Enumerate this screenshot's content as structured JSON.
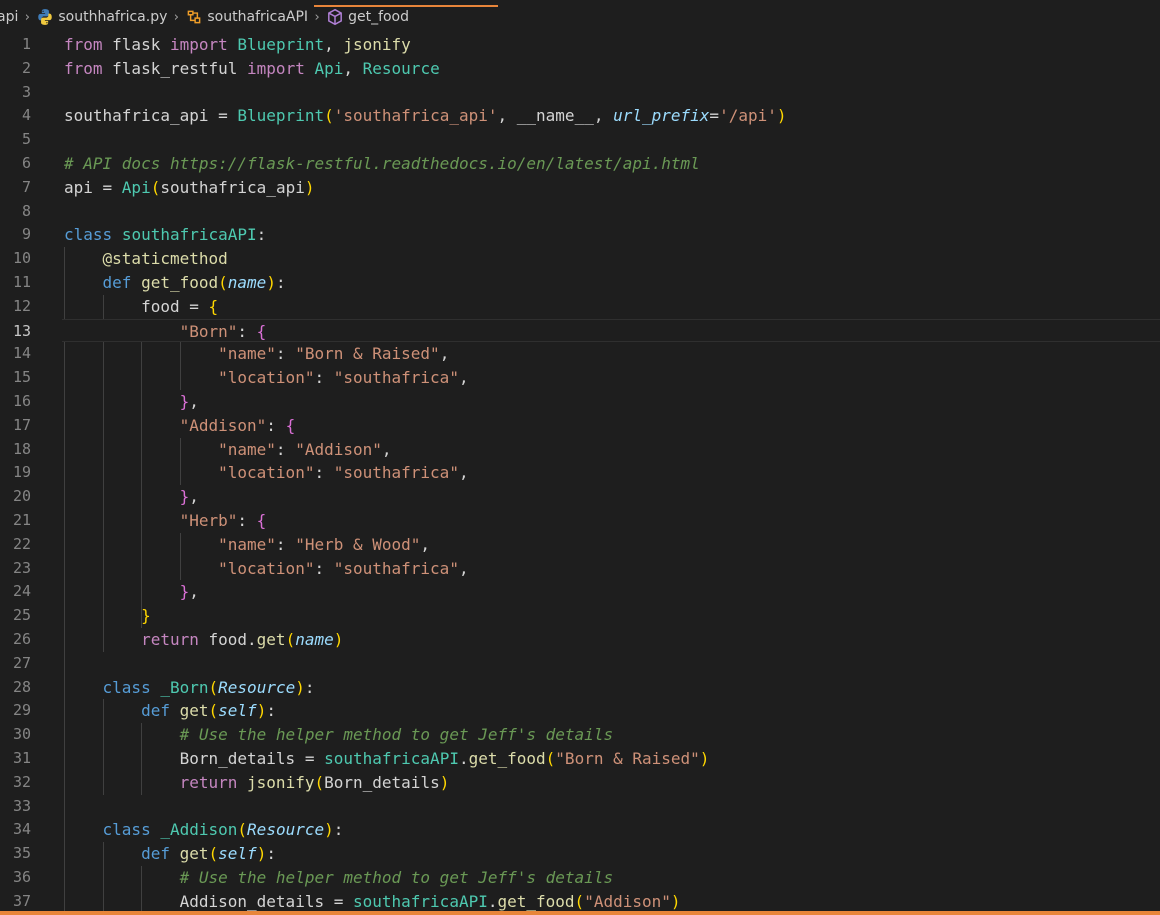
{
  "breadcrumb": {
    "root": "api",
    "file": "southhafrica.py",
    "class": "southafricaAPI",
    "method": "get_food"
  },
  "editor": {
    "active_line": 13,
    "lines": [
      {
        "n": "1",
        "segs": [
          [
            "kw",
            "from"
          ],
          [
            "punc",
            " flask "
          ],
          [
            "kw",
            "import"
          ],
          [
            "punc",
            " "
          ],
          [
            "cls",
            "Blueprint"
          ],
          [
            "punc",
            ", "
          ],
          [
            "func",
            "jsonify"
          ]
        ]
      },
      {
        "n": "2",
        "segs": [
          [
            "kw",
            "from"
          ],
          [
            "punc",
            " flask_restful "
          ],
          [
            "kw",
            "import"
          ],
          [
            "punc",
            " "
          ],
          [
            "cls",
            "Api"
          ],
          [
            "punc",
            ", "
          ],
          [
            "cls",
            "Resource"
          ]
        ]
      },
      {
        "n": "3",
        "segs": []
      },
      {
        "n": "4",
        "segs": [
          [
            "punc",
            "southafrica_api = "
          ],
          [
            "cls",
            "Blueprint"
          ],
          [
            "br1",
            "("
          ],
          [
            "str",
            "'southafrica_api'"
          ],
          [
            "punc",
            ", __name__, "
          ],
          [
            "param",
            "url_prefix"
          ],
          [
            "punc",
            "="
          ],
          [
            "str",
            "'/api'"
          ],
          [
            "br1",
            ")"
          ]
        ]
      },
      {
        "n": "5",
        "segs": []
      },
      {
        "n": "6",
        "segs": [
          [
            "cmt",
            "# API docs https://flask-restful.readthedocs.io/en/latest/api.html"
          ]
        ]
      },
      {
        "n": "7",
        "segs": [
          [
            "punc",
            "api = "
          ],
          [
            "cls",
            "Api"
          ],
          [
            "br1",
            "("
          ],
          [
            "punc",
            "southafrica_api"
          ],
          [
            "br1",
            ")"
          ]
        ]
      },
      {
        "n": "8",
        "segs": []
      },
      {
        "n": "9",
        "segs": [
          [
            "kwb",
            "class"
          ],
          [
            "punc",
            " "
          ],
          [
            "cls",
            "southafricaAPI"
          ],
          [
            "punc",
            ":"
          ]
        ]
      },
      {
        "n": "10",
        "segs": [
          [
            "punc",
            "    "
          ],
          [
            "dec",
            "@staticmethod"
          ]
        ]
      },
      {
        "n": "11",
        "segs": [
          [
            "punc",
            "    "
          ],
          [
            "kwb",
            "def"
          ],
          [
            "punc",
            " "
          ],
          [
            "func",
            "get_food"
          ],
          [
            "br1",
            "("
          ],
          [
            "param",
            "name"
          ],
          [
            "br1",
            ")"
          ],
          [
            "punc",
            ":"
          ]
        ]
      },
      {
        "n": "12",
        "segs": [
          [
            "punc",
            "        food = "
          ],
          [
            "br1",
            "{"
          ]
        ]
      },
      {
        "n": "13",
        "segs": [
          [
            "punc",
            "            "
          ],
          [
            "str",
            "\"Born\""
          ],
          [
            "punc",
            ": "
          ],
          [
            "br2",
            "{"
          ]
        ]
      },
      {
        "n": "14",
        "segs": [
          [
            "punc",
            "                "
          ],
          [
            "str",
            "\"name\""
          ],
          [
            "punc",
            ": "
          ],
          [
            "str",
            "\"Born & Raised\""
          ],
          [
            "punc",
            ","
          ]
        ]
      },
      {
        "n": "15",
        "segs": [
          [
            "punc",
            "                "
          ],
          [
            "str",
            "\"location\""
          ],
          [
            "punc",
            ": "
          ],
          [
            "str",
            "\"southafrica\""
          ],
          [
            "punc",
            ","
          ]
        ]
      },
      {
        "n": "16",
        "segs": [
          [
            "punc",
            "            "
          ],
          [
            "br2",
            "}"
          ],
          [
            "punc",
            ","
          ]
        ]
      },
      {
        "n": "17",
        "segs": [
          [
            "punc",
            "            "
          ],
          [
            "str",
            "\"Addison\""
          ],
          [
            "punc",
            ": "
          ],
          [
            "br2",
            "{"
          ]
        ]
      },
      {
        "n": "18",
        "segs": [
          [
            "punc",
            "                "
          ],
          [
            "str",
            "\"name\""
          ],
          [
            "punc",
            ": "
          ],
          [
            "str",
            "\"Addison\""
          ],
          [
            "punc",
            ","
          ]
        ]
      },
      {
        "n": "19",
        "segs": [
          [
            "punc",
            "                "
          ],
          [
            "str",
            "\"location\""
          ],
          [
            "punc",
            ": "
          ],
          [
            "str",
            "\"southafrica\""
          ],
          [
            "punc",
            ","
          ]
        ]
      },
      {
        "n": "20",
        "segs": [
          [
            "punc",
            "            "
          ],
          [
            "br2",
            "}"
          ],
          [
            "punc",
            ","
          ]
        ]
      },
      {
        "n": "21",
        "segs": [
          [
            "punc",
            "            "
          ],
          [
            "str",
            "\"Herb\""
          ],
          [
            "punc",
            ": "
          ],
          [
            "br2",
            "{"
          ]
        ]
      },
      {
        "n": "22",
        "segs": [
          [
            "punc",
            "                "
          ],
          [
            "str",
            "\"name\""
          ],
          [
            "punc",
            ": "
          ],
          [
            "str",
            "\"Herb & Wood\""
          ],
          [
            "punc",
            ","
          ]
        ]
      },
      {
        "n": "23",
        "segs": [
          [
            "punc",
            "                "
          ],
          [
            "str",
            "\"location\""
          ],
          [
            "punc",
            ": "
          ],
          [
            "str",
            "\"southafrica\""
          ],
          [
            "punc",
            ","
          ]
        ]
      },
      {
        "n": "24",
        "segs": [
          [
            "punc",
            "            "
          ],
          [
            "br2",
            "}"
          ],
          [
            "punc",
            ","
          ]
        ]
      },
      {
        "n": "25",
        "segs": [
          [
            "punc",
            "        "
          ],
          [
            "br1",
            "}"
          ]
        ]
      },
      {
        "n": "26",
        "segs": [
          [
            "punc",
            "        "
          ],
          [
            "kw",
            "return"
          ],
          [
            "punc",
            " food."
          ],
          [
            "func",
            "get"
          ],
          [
            "br1",
            "("
          ],
          [
            "param",
            "name"
          ],
          [
            "br1",
            ")"
          ]
        ]
      },
      {
        "n": "27",
        "segs": []
      },
      {
        "n": "28",
        "segs": [
          [
            "punc",
            "    "
          ],
          [
            "kwb",
            "class"
          ],
          [
            "punc",
            " "
          ],
          [
            "cls",
            "_Born"
          ],
          [
            "br1",
            "("
          ],
          [
            "param",
            "Resource"
          ],
          [
            "br1",
            ")"
          ],
          [
            "punc",
            ":"
          ]
        ]
      },
      {
        "n": "29",
        "segs": [
          [
            "punc",
            "        "
          ],
          [
            "kwb",
            "def"
          ],
          [
            "punc",
            " "
          ],
          [
            "func",
            "get"
          ],
          [
            "br1",
            "("
          ],
          [
            "param",
            "self"
          ],
          [
            "br1",
            ")"
          ],
          [
            "punc",
            ":"
          ]
        ]
      },
      {
        "n": "30",
        "segs": [
          [
            "punc",
            "            "
          ],
          [
            "cmt",
            "# Use the helper method to get Jeff's details"
          ]
        ]
      },
      {
        "n": "31",
        "segs": [
          [
            "punc",
            "            Born_details = "
          ],
          [
            "cls",
            "southafricaAPI"
          ],
          [
            "punc",
            "."
          ],
          [
            "func",
            "get_food"
          ],
          [
            "br1",
            "("
          ],
          [
            "str",
            "\"Born & Raised\""
          ],
          [
            "br1",
            ")"
          ]
        ]
      },
      {
        "n": "32",
        "segs": [
          [
            "punc",
            "            "
          ],
          [
            "kw",
            "return"
          ],
          [
            "punc",
            " "
          ],
          [
            "func",
            "jsonify"
          ],
          [
            "br1",
            "("
          ],
          [
            "punc",
            "Born_details"
          ],
          [
            "br1",
            ")"
          ]
        ]
      },
      {
        "n": "33",
        "segs": []
      },
      {
        "n": "34",
        "segs": [
          [
            "punc",
            "    "
          ],
          [
            "kwb",
            "class"
          ],
          [
            "punc",
            " "
          ],
          [
            "cls",
            "_Addison"
          ],
          [
            "br1",
            "("
          ],
          [
            "param",
            "Resource"
          ],
          [
            "br1",
            ")"
          ],
          [
            "punc",
            ":"
          ]
        ]
      },
      {
        "n": "35",
        "segs": [
          [
            "punc",
            "        "
          ],
          [
            "kwb",
            "def"
          ],
          [
            "punc",
            " "
          ],
          [
            "func",
            "get"
          ],
          [
            "br1",
            "("
          ],
          [
            "param",
            "self"
          ],
          [
            "br1",
            ")"
          ],
          [
            "punc",
            ":"
          ]
        ]
      },
      {
        "n": "36",
        "segs": [
          [
            "punc",
            "            "
          ],
          [
            "cmt",
            "# Use the helper method to get Jeff's details"
          ]
        ]
      },
      {
        "n": "37",
        "segs": [
          [
            "punc",
            "            Addison_details = "
          ],
          [
            "cls",
            "southafricaAPI"
          ],
          [
            "punc",
            "."
          ],
          [
            "func",
            "get_food"
          ],
          [
            "br1",
            "("
          ],
          [
            "str",
            "\"Addison\""
          ],
          [
            "br1",
            ")"
          ]
        ]
      }
    ]
  },
  "colors": {
    "background": "#1e1e1e",
    "accent": "#e8853a",
    "keyword": "#c586c0",
    "keyword_blue": "#569cd6",
    "class": "#4ec9b0",
    "function": "#dcdcaa",
    "string": "#ce9178",
    "parameter": "#9cdcfe",
    "comment": "#6a9955"
  },
  "icons": {
    "file": "python-icon",
    "class": "class-symbol-icon",
    "method": "method-cube-icon",
    "separator": "chevron-right-icon"
  }
}
